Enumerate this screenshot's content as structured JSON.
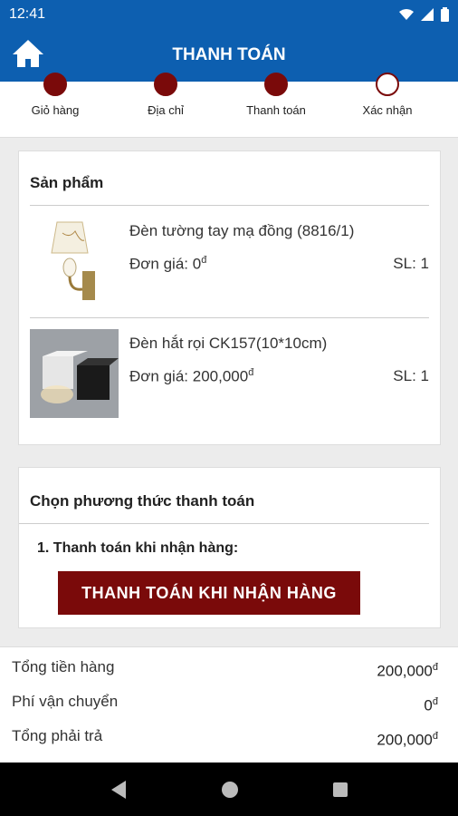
{
  "status": {
    "time": "12:41"
  },
  "header": {
    "title": "THANH TOÁN"
  },
  "steps": [
    {
      "label": "Giỏ hàng",
      "done": true
    },
    {
      "label": "Địa chỉ",
      "done": true
    },
    {
      "label": "Thanh toán",
      "done": true
    },
    {
      "label": "Xác nhận",
      "done": false
    }
  ],
  "products": {
    "title": "Sản phẩm",
    "items": [
      {
        "name": "Đèn tường tay mạ đồng (8816/1)",
        "price_label": "Đơn giá: 0",
        "currency": "đ",
        "qty": "SL: 1"
      },
      {
        "name": "Đèn hắt rọi CK157(10*10cm)",
        "price_label": "Đơn giá: 200,000",
        "currency": "đ",
        "qty": "SL: 1"
      }
    ]
  },
  "payment": {
    "title": "Chọn phương thức thanh toán",
    "option_label": "1. Thanh toán khi nhận hàng:",
    "button_label": "THANH TOÁN KHI NHẬN HÀNG"
  },
  "totals": {
    "subtotal_label": "Tổng tiền hàng",
    "subtotal_value": "200,000",
    "shipping_label": "Phí vận chuyển",
    "shipping_value": "0",
    "total_label": "Tổng phải trả",
    "total_value": "200,000",
    "currency": "đ"
  },
  "colors": {
    "primary": "#0d5fb0",
    "accent": "#7a0a0a"
  }
}
